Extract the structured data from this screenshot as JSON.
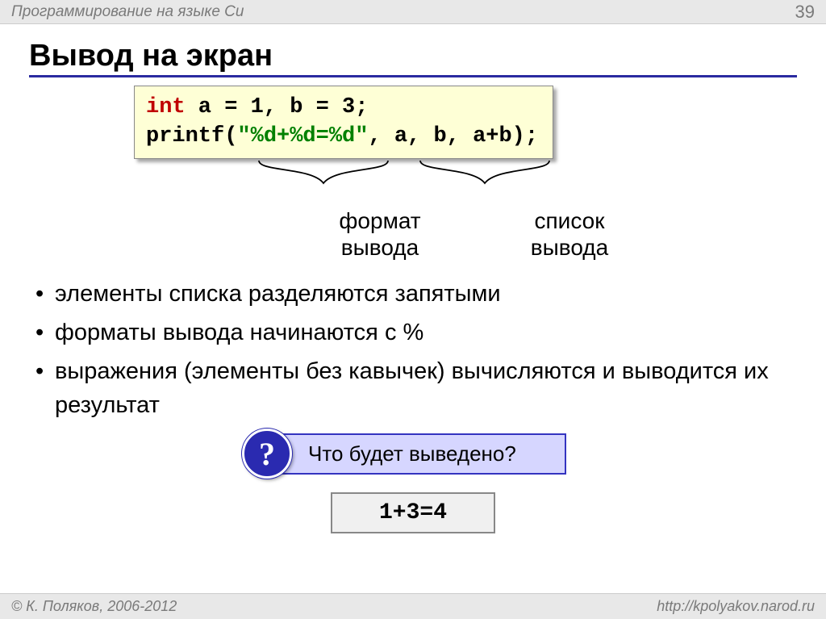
{
  "header": {
    "course_title": "Программирование на языке Си",
    "page_number": "39"
  },
  "title": "Вывод на экран",
  "code": {
    "line1_kw": "int",
    "line1_rest": " a = 1, b = 3;",
    "line2_pre": "printf(",
    "line2_str": "\"%d+%d=%d\"",
    "line2_post": ", a, b, a+b);"
  },
  "annotations": {
    "format_label_l1": "формат",
    "format_label_l2": "вывода",
    "list_label_l1": "список",
    "list_label_l2": "вывода"
  },
  "bullets": [
    "элементы списка разделяются запятыми",
    "форматы вывода начинаются с %",
    "выражения (элементы без кавычек) вычисляются и выводится их результат"
  ],
  "question": {
    "icon": "?",
    "text": "Что будет выведено?"
  },
  "output": "1+3=4",
  "footer": {
    "copyright": "© К. Поляков, 2006-2012",
    "url": "http://kpolyakov.narod.ru"
  }
}
